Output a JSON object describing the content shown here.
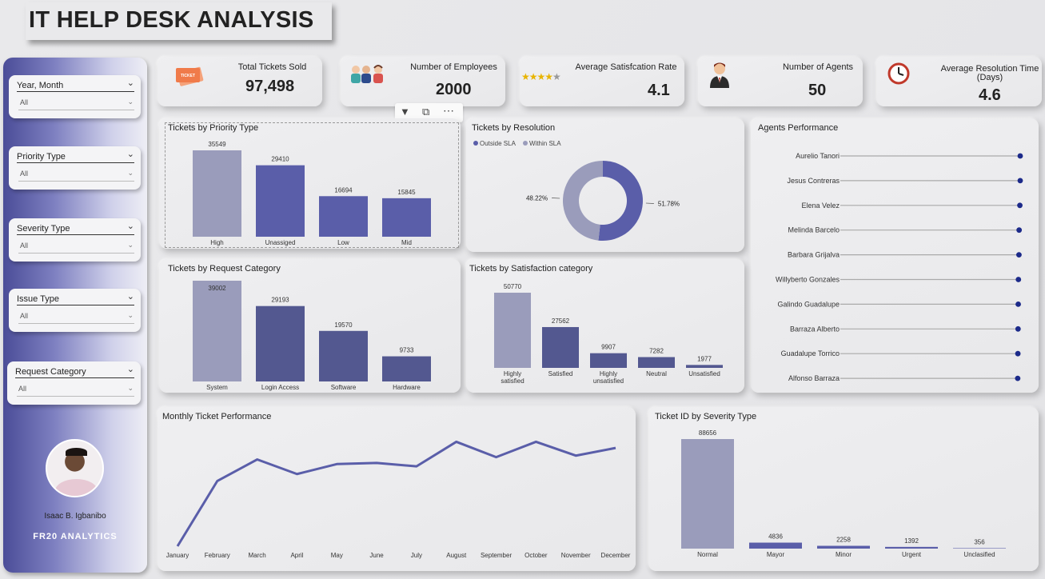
{
  "title": "IT HELP DESK ANALYSIS",
  "colors": {
    "primary": "#5a5ea9",
    "light": "#9a9cbb",
    "dark": "#535890",
    "dot": "#1c2a8a"
  },
  "slicers": [
    {
      "label": "Year, Month",
      "value": "All"
    },
    {
      "label": "Priority Type",
      "value": "All"
    },
    {
      "label": "Severity Type",
      "value": "All"
    },
    {
      "label": "Issue Type",
      "value": "All"
    },
    {
      "label": "Request Category",
      "value": "All"
    }
  ],
  "profile": {
    "name": "Isaac B. Igbanibo",
    "brand": "FR20 ANALYTICS"
  },
  "kpis": {
    "tickets": {
      "label": "Total Tickets Sold",
      "value": "97,498",
      "icon": "ticket-icon",
      "icon_text": "TICKET"
    },
    "employees": {
      "label": "Number of Employees",
      "value": "2000",
      "icon": "people-icon"
    },
    "satisfaction": {
      "label": "Average Satisfcation Rate",
      "value": "4.1",
      "icon": "stars-icon",
      "stars": 4
    },
    "agents": {
      "label": "Number of Agents",
      "value": "50",
      "icon": "agent-icon"
    },
    "resolution": {
      "label": "Average Resolution Time (Days)",
      "value": "4.6",
      "icon": "clock-icon"
    }
  },
  "chart_data": [
    {
      "id": "priority",
      "type": "bar",
      "title": "Tickets by Priority Type",
      "categories": [
        "High",
        "Unassiged",
        "Low",
        "Mid"
      ],
      "values": [
        35549,
        29410,
        16694,
        15845
      ]
    },
    {
      "id": "resolution",
      "type": "pie",
      "title": "Tickets by Resolution",
      "series": [
        {
          "name": "Outside SLA",
          "value": 51.78,
          "label": "51.78%"
        },
        {
          "name": "Within SLA",
          "value": 48.22,
          "label": "48.22%"
        }
      ]
    },
    {
      "id": "agents",
      "type": "scatter",
      "title": "Agents Performance",
      "categories": [
        "Aurelio Tanori",
        "Jesus Contreras",
        "Elena Velez",
        "Melinda Barcelo",
        "Barbara Grijalva",
        "Willyberto Gonzales",
        "Galindo Guadalupe",
        "Barraza Alberto",
        "Guadalupe Torrico",
        "Alfonso Barraza"
      ],
      "values": [
        100,
        100,
        99.8,
        99.4,
        99.3,
        99.0,
        98.9,
        98.8,
        98.7,
        98.6
      ]
    },
    {
      "id": "request",
      "type": "bar",
      "title": "Tickets by Request Category",
      "categories": [
        "System",
        "Login Access",
        "Software",
        "Hardware"
      ],
      "values": [
        39002,
        29193,
        19570,
        9733
      ]
    },
    {
      "id": "satisfaction",
      "type": "bar",
      "title": "Tickets by Satisfaction category",
      "categories": [
        "Highly satisfied",
        "Satisfied",
        "Highly unsatisfied",
        "Neutral",
        "Unsatisfied"
      ],
      "values": [
        50770,
        27562,
        9907,
        7282,
        1977
      ]
    },
    {
      "id": "monthly",
      "type": "line",
      "title": "Monthly Ticket Performance",
      "categories": [
        "January",
        "February",
        "March",
        "April",
        "May",
        "June",
        "July",
        "August",
        "September",
        "October",
        "November",
        "December"
      ],
      "values": [
        7200,
        8050,
        8330,
        8140,
        8270,
        8285,
        8240,
        8560,
        8360,
        8560,
        8380,
        8480
      ],
      "ylim": [
        7200,
        8700
      ]
    },
    {
      "id": "severity",
      "type": "bar",
      "title": "Ticket ID by Severity Type",
      "categories": [
        "Normal",
        "Mayor",
        "Minor",
        "Urgent",
        "Unclasified"
      ],
      "values": [
        88656,
        4836,
        2258,
        1392,
        356
      ]
    }
  ]
}
